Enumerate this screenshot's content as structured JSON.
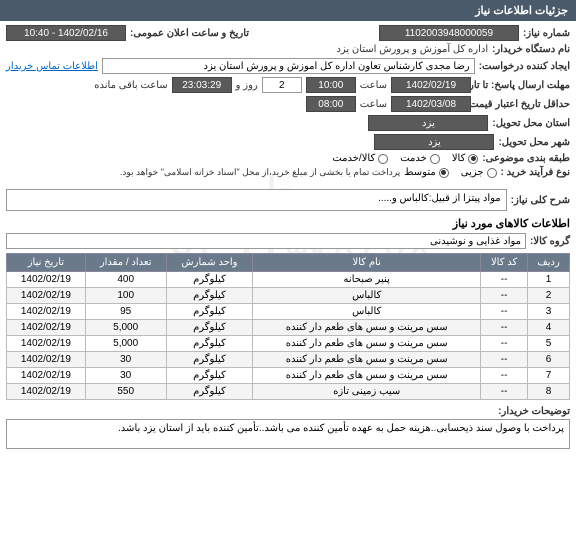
{
  "header": {
    "title": "جزئیات اطلاعات نیاز"
  },
  "watermark": {
    "line1": "ستاد",
    "line2": "۰۲۱-۸۸۳۴۹۶۷۵"
  },
  "fields": {
    "need_no_label": "شماره نیاز:",
    "need_no": "1102003948000059",
    "announce_label": "تاریخ و ساعت اعلان عمومی:",
    "announce": "1402/02/16 - 10:40",
    "buyer_dev_label": "نام دستگاه خریدار:",
    "buyer_dev": "اداره کل آموزش و پرورش استان یزد",
    "creator_label": "ایجاد کننده درخواست:",
    "creator": "رضا مجدی کارشناس تعاون اداره کل اموزش و پرورش استان یزد",
    "buyer_info_link": "اطلاعات تماس خریدار",
    "deadline_label": "مهلت ارسال پاسخ: تا تاریخ:",
    "deadline_date": "1402/02/19",
    "time_label": "ساعت",
    "deadline_time": "10:00",
    "days_label": "روز و",
    "days": "2",
    "remain_label": "ساعت باقی مانده",
    "remain": "23:03:29",
    "valid_label": "حداقل تاریخ اعتبار قیمت: تا تاریخ:",
    "valid_date": "1402/03/08",
    "valid_time": "08:00",
    "province_label": "استان محل تحویل:",
    "province": "یزد",
    "city_label": "شهر محل تحویل:",
    "city": "یزد",
    "class_label": "طبقه بندی موضوعی:",
    "class_opt1": "کالا",
    "class_opt2": "خدمت",
    "class_opt3": "کالا/خدمت",
    "buy_type_label": "نوع فرآیند خرید :",
    "buy_opt1": "جزیی",
    "buy_opt2": "متوسط",
    "buy_note": "پرداخت تمام یا بخشی از مبلغ خرید،از محل \"اسناد خزانه اسلامی\" خواهد بود.",
    "summary_label": "شرح کلی نیاز:",
    "summary": "مواد پیتزا از قبیل:کالباس و.....",
    "items_title": "اطلاعات کالاهای مورد نیاز",
    "group_label": "گروه کالا:",
    "group": "مواد غذایی و نوشیدنی",
    "notes_label": "توضیحات خریدار:",
    "notes": "پرداخت با وصول سند ذیحسابی..هزینه حمل به عهده تأمین کننده می باشد..تأمین کننده باید از استان یزد باشد."
  },
  "table": {
    "headers": [
      "ردیف",
      "کد کالا",
      "نام کالا",
      "واحد شمارش",
      "تعداد / مقدار",
      "تاریخ نیاز"
    ],
    "rows": [
      {
        "idx": "1",
        "code": "--",
        "name": "پنیر صبحانه",
        "unit": "کیلوگرم",
        "qty": "400",
        "date": "1402/02/19"
      },
      {
        "idx": "2",
        "code": "--",
        "name": "کالباس",
        "unit": "کیلوگرم",
        "qty": "100",
        "date": "1402/02/19"
      },
      {
        "idx": "3",
        "code": "--",
        "name": "کالباس",
        "unit": "کیلوگرم",
        "qty": "95",
        "date": "1402/02/19"
      },
      {
        "idx": "4",
        "code": "--",
        "name": "سس مرینت و سس های طعم دار کننده",
        "unit": "کیلوگرم",
        "qty": "5,000",
        "date": "1402/02/19"
      },
      {
        "idx": "5",
        "code": "--",
        "name": "سس مرینت و سس های طعم دار کننده",
        "unit": "کیلوگرم",
        "qty": "5,000",
        "date": "1402/02/19"
      },
      {
        "idx": "6",
        "code": "--",
        "name": "سس مرینت و سس های طعم دار کننده",
        "unit": "کیلوگرم",
        "qty": "30",
        "date": "1402/02/19"
      },
      {
        "idx": "7",
        "code": "--",
        "name": "سس مرینت و سس های طعم دار کننده",
        "unit": "کیلوگرم",
        "qty": "30",
        "date": "1402/02/19"
      },
      {
        "idx": "8",
        "code": "--",
        "name": "سیب زمینی تازه",
        "unit": "کیلوگرم",
        "qty": "550",
        "date": "1402/02/19"
      }
    ]
  }
}
